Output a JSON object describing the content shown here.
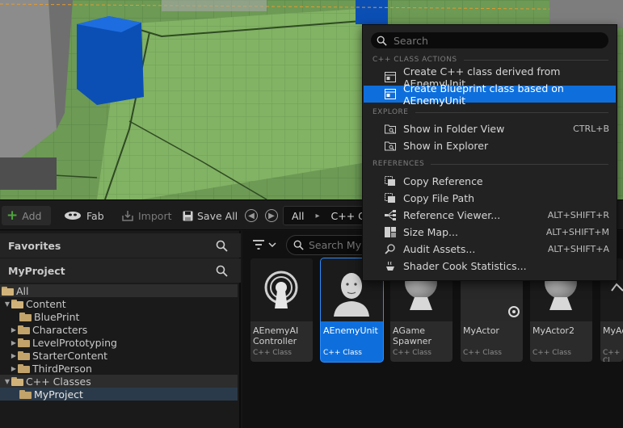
{
  "toolbar": {
    "add_label": "Add",
    "fab_label": "Fab",
    "import_label": "Import",
    "saveall_label": "Save All",
    "breadcrumb": [
      "All",
      "C++ Cla"
    ]
  },
  "left_panel": {
    "favorites_title": "Favorites",
    "project_title": "MyProject",
    "tree": [
      {
        "label": "All"
      },
      {
        "label": "Content"
      },
      {
        "label": "BluePrint"
      },
      {
        "label": "Characters"
      },
      {
        "label": "LevelPrototyping"
      },
      {
        "label": "StarterContent"
      },
      {
        "label": "ThirdPerson"
      },
      {
        "label": "C++ Classes"
      },
      {
        "label": "MyProject"
      }
    ]
  },
  "content": {
    "search_placeholder": "Search MyP",
    "tiles": [
      {
        "name": "AEnemyAI Controller",
        "kind": "C++ Class"
      },
      {
        "name": "AEnemyUnit",
        "kind": "C++ Class"
      },
      {
        "name": "AGame Spawner",
        "kind": "C++ Class"
      },
      {
        "name": "MyActor",
        "kind": "C++ Class"
      },
      {
        "name": "MyActor2",
        "kind": "C++ Class"
      },
      {
        "name": "MyAc Insta",
        "kind": "C++ Cl"
      }
    ]
  },
  "context_menu": {
    "search_placeholder": "Search",
    "sections": {
      "cpp": "C++ CLASS ACTIONS",
      "explore": "EXPLORE",
      "references": "REFERENCES"
    },
    "items": [
      {
        "label": "Create C++ class derived from AEnemyUnit",
        "shortcut": "",
        "icon": "class-icon"
      },
      {
        "label": "Create Blueprint class based on AEnemyUnit",
        "shortcut": "",
        "icon": "blueprint-class-icon"
      },
      {
        "label": "Show in Folder View",
        "shortcut": "CTRL+B",
        "icon": "folder-search-icon"
      },
      {
        "label": "Show in Explorer",
        "shortcut": "",
        "icon": "folder-search-icon"
      },
      {
        "label": "Copy Reference",
        "shortcut": "",
        "icon": "copy-reference-icon"
      },
      {
        "label": "Copy File Path",
        "shortcut": "",
        "icon": "copy-path-icon"
      },
      {
        "label": "Reference Viewer...",
        "shortcut": "ALT+SHIFT+R",
        "icon": "reference-viewer-icon"
      },
      {
        "label": "Size Map...",
        "shortcut": "ALT+SHIFT+M",
        "icon": "size-map-icon"
      },
      {
        "label": "Audit Assets...",
        "shortcut": "ALT+SHIFT+A",
        "icon": "audit-icon"
      },
      {
        "label": "Shader Cook Statistics...",
        "shortcut": "",
        "icon": "shader-icon"
      }
    ]
  },
  "colors": {
    "accent": "#0e6fdc",
    "folder": "#c2a36a",
    "add_plus": "#4ea53b"
  }
}
